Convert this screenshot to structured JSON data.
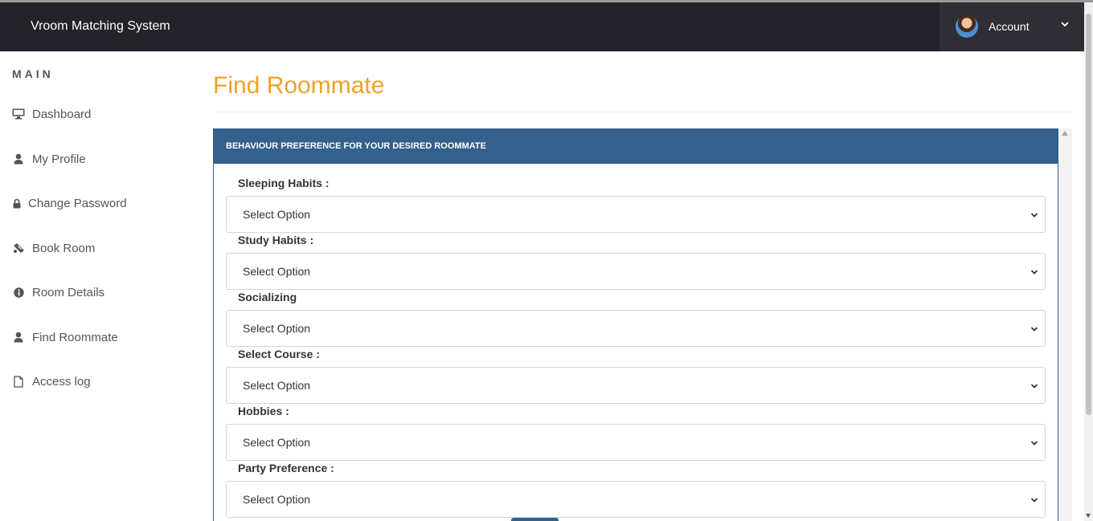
{
  "app": {
    "title": "Vroom Matching System"
  },
  "account": {
    "label": "Account",
    "avatar_icon": "user-avatar",
    "caret_icon": "chevron-down-icon"
  },
  "sidebar": {
    "heading": "MAIN",
    "items": [
      {
        "label": "Dashboard",
        "icon": "desktop-icon"
      },
      {
        "label": "My Profile",
        "icon": "user-icon"
      },
      {
        "label": "Change Password",
        "icon": "lock-icon"
      },
      {
        "label": "Book Room",
        "icon": "ticket-icon"
      },
      {
        "label": "Room Details",
        "icon": "info-circle-icon"
      },
      {
        "label": "Find Roommate",
        "icon": "user-icon"
      },
      {
        "label": "Access log",
        "icon": "file-icon"
      }
    ]
  },
  "page": {
    "title": "Find Roommate",
    "panel_heading": "BEHAVIOUR PREFERENCE FOR YOUR DESIRED ROOMMATE",
    "fields": [
      {
        "label": "Sleeping Habits :",
        "value": "Select Option"
      },
      {
        "label": "Study Habits :",
        "value": "Select Option"
      },
      {
        "label": "Socializing",
        "value": "Select Option"
      },
      {
        "label": "Select Course :",
        "value": "Select Option"
      },
      {
        "label": "Hobbies :",
        "value": "Select Option"
      },
      {
        "label": "Party Preference :",
        "value": "Select Option"
      }
    ]
  },
  "colors": {
    "topbar": "#25232a",
    "accent_title": "#f0a02e",
    "panel_header": "#33618c"
  }
}
